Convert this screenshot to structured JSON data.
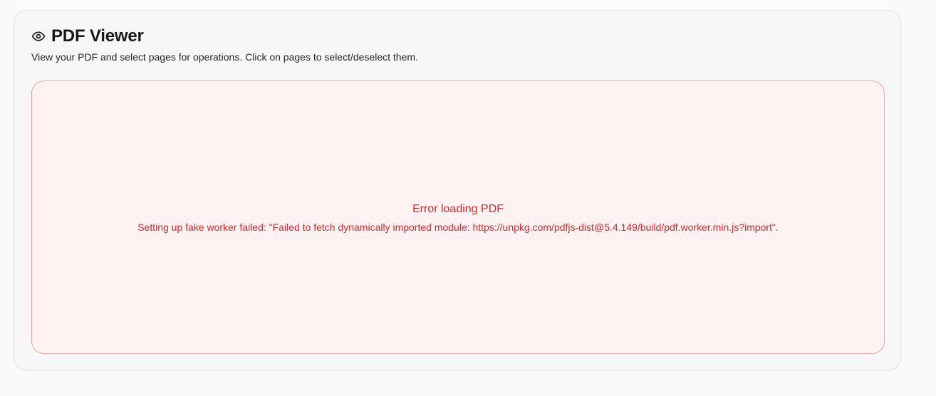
{
  "viewer": {
    "title": "PDF Viewer",
    "title_icon": "eye-icon",
    "subtitle": "View your PDF and select pages for operations. Click on pages to select/deselect them."
  },
  "error": {
    "title": "Error loading PDF",
    "message": "Setting up fake worker failed: \"Failed to fetch dynamically imported module: https://unpkg.com/pdfjs-dist@5.4.149/build/pdf.worker.min.js?import\"."
  },
  "colors": {
    "error_text": "#dc2626",
    "error_border": "#f6a5a5",
    "error_background": "#fef2f2",
    "card_background": "#f7f7f8"
  }
}
